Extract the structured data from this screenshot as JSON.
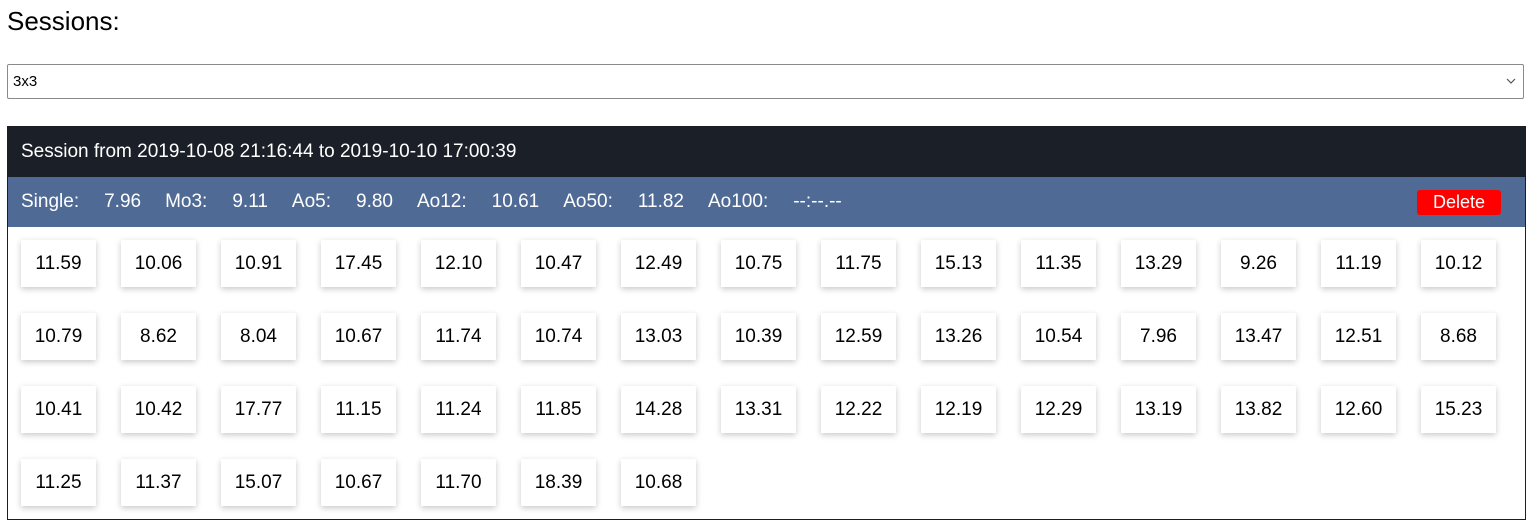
{
  "heading": "Sessions:",
  "session_select": {
    "value": "3x3"
  },
  "session": {
    "title": "Session from 2019-10-08 21:16:44 to 2019-10-10 17:00:39",
    "stats": [
      {
        "label": "Single:",
        "value": "7.96"
      },
      {
        "label": "Mo3:",
        "value": "9.11"
      },
      {
        "label": "Ao5:",
        "value": "9.80"
      },
      {
        "label": "Ao12:",
        "value": "10.61"
      },
      {
        "label": "Ao50:",
        "value": "11.82"
      },
      {
        "label": "Ao100:",
        "value": "--:--.--"
      }
    ],
    "delete_label": "Delete",
    "rows": [
      [
        "11.59",
        "10.06",
        "10.91",
        "17.45",
        "12.10",
        "10.47",
        "12.49",
        "10.75",
        "11.75",
        "15.13",
        "11.35",
        "13.29",
        "9.26",
        "11.19",
        "10.12"
      ],
      [
        "10.79",
        "8.62",
        "8.04",
        "10.67",
        "11.74",
        "10.74",
        "13.03",
        "10.39",
        "12.59",
        "13.26",
        "10.54",
        "7.96",
        "13.47",
        "12.51",
        "8.68"
      ],
      [
        "10.41",
        "10.42",
        "17.77",
        "11.15",
        "11.24",
        "11.85",
        "14.28",
        "13.31",
        "12.22",
        "12.19",
        "12.29",
        "13.19",
        "13.82",
        "12.60",
        "15.23"
      ],
      [
        "11.25",
        "11.37",
        "15.07",
        "10.67",
        "11.70",
        "18.39",
        "10.68"
      ]
    ]
  },
  "colors": {
    "header_bg": "#1b1f27",
    "stats_bg": "#4e6a95",
    "delete_bg": "#ff0000"
  },
  "icons": {
    "select_arrow": "chevron-down-icon"
  }
}
